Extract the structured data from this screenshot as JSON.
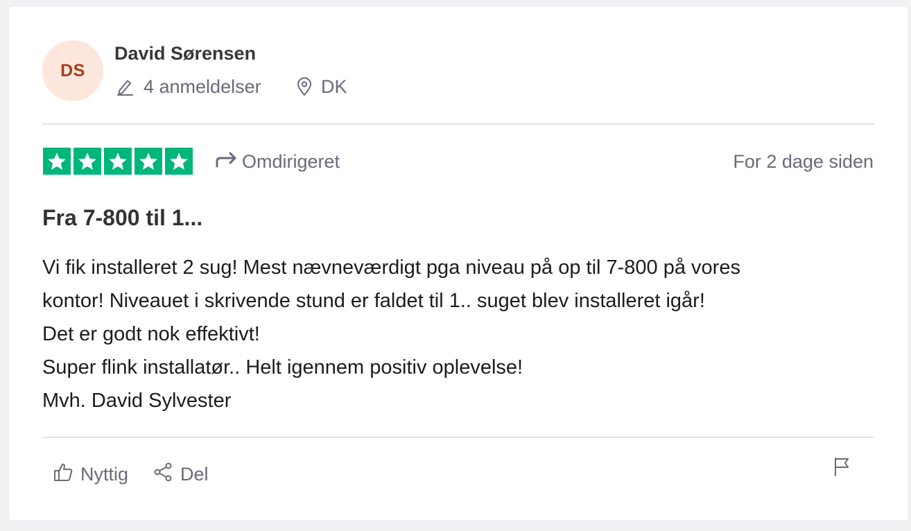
{
  "author": {
    "initials": "DS",
    "name": "David Sørensen",
    "reviews_count_label": "4 anmeldelser",
    "country": "DK",
    "avatar_bg": "#fde7dc",
    "avatar_text_color": "#a83e1e"
  },
  "rating": {
    "stars": 5,
    "max": 5,
    "color": "#00b67a"
  },
  "review": {
    "source_label": "Omdirigeret",
    "date_label": "For 2 dage siden",
    "title": "Fra 7-800 til 1...",
    "body_lines": [
      "Vi fik installeret 2 sug! Mest nævneværdigt pga niveau på op til 7-800 på vores",
      "kontor! Niveauet i skrivende stund er faldet til 1.. suget blev installeret igår!",
      "Det er godt nok effektivt!",
      "Super flink installatør.. Helt igennem positiv oplevelse!",
      "Mvh. David Sylvester"
    ]
  },
  "actions": {
    "useful_label": "Nyttig",
    "share_label": "Del"
  },
  "icons": {
    "reviews": "pencil-icon",
    "country": "location-pin-icon",
    "source": "redirect-arrow-icon",
    "useful": "thumbs-up-icon",
    "share": "share-icon",
    "report": "flag-icon",
    "rating": "star-icon"
  }
}
